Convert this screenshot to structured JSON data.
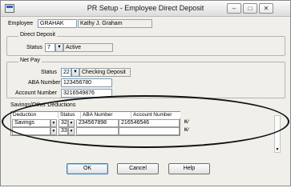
{
  "window": {
    "title": "PR Setup - Employee Direct Deposit",
    "controls": {
      "minimize": "–",
      "maximize": "□",
      "close": "✕"
    }
  },
  "employee": {
    "label": "Employee",
    "id": "GRAHAK",
    "name": "Kathy J. Graham"
  },
  "direct_deposit": {
    "group_label": "Direct Deposit",
    "status_label": "Status",
    "status_code": "7",
    "status_text": "Active"
  },
  "net_pay": {
    "group_label": "Net Pay",
    "status_label": "Status",
    "status_code": "22",
    "status_text": "Checking Deposit",
    "aba_label": "ABA Number",
    "aba_value": "123456780",
    "account_label": "Account Number",
    "account_value": "3216549876"
  },
  "deductions": {
    "group_label": "Savings/Other Deductions",
    "columns": [
      "Deduction",
      "Status",
      "ABA Number",
      "Account Number"
    ],
    "rows": [
      {
        "deduction": "Savings",
        "status": "32",
        "aba": "234567898",
        "account": "216546546"
      },
      {
        "deduction": "",
        "status": "33",
        "aba": "",
        "account": ""
      }
    ]
  },
  "buttons": {
    "ok": "OK",
    "cancel": "Cancel",
    "help": "Help"
  },
  "icons": {
    "dropdown": "dropdown-arrow-icon",
    "row_action": "row-action-icon"
  },
  "colors": {
    "annotation_ellipse": "#111111",
    "field_border": "#7f9db9"
  }
}
